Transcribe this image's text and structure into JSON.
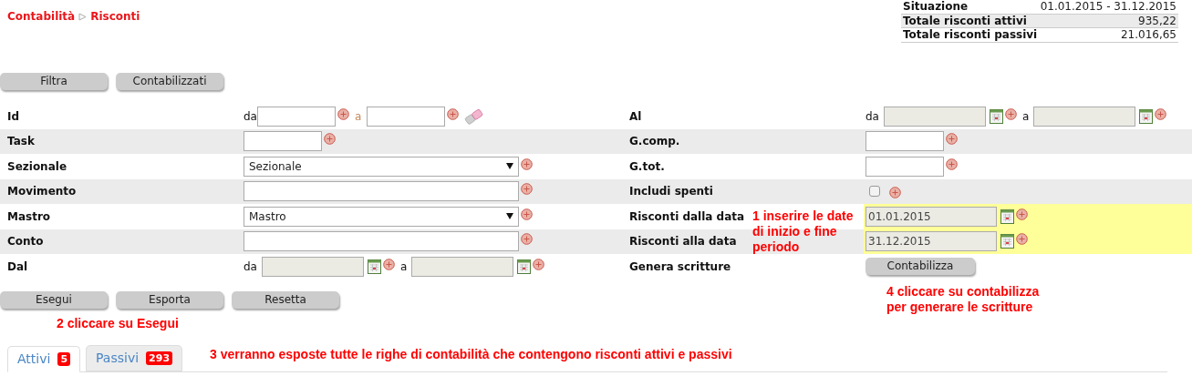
{
  "breadcrumb": [
    {
      "label": "Contabilità"
    },
    {
      "label": "Risconti"
    }
  ],
  "summary": [
    {
      "label": "Situazione",
      "value": "01.01.2015 - 31.12.2015"
    },
    {
      "label": "Totale risconti attivi",
      "value": "935,22"
    },
    {
      "label": "Totale risconti passivi",
      "value": "21.016,65"
    }
  ],
  "top_buttons": [
    "Filtra",
    "Contabilizzati"
  ],
  "filters_left": [
    {
      "label": "Id",
      "kind": "range",
      "from": "da",
      "to": "a"
    },
    {
      "label": "Task",
      "kind": "short"
    },
    {
      "label": "Sezionale",
      "kind": "select",
      "value": "Sezionale"
    },
    {
      "label": "Movimento",
      "kind": "text"
    },
    {
      "label": "Mastro",
      "kind": "select",
      "value": "Mastro"
    },
    {
      "label": "Conto",
      "kind": "text"
    },
    {
      "label": "Dal",
      "kind": "daterange",
      "from": "da",
      "to": "a"
    }
  ],
  "filters_right": [
    {
      "label": "Al",
      "kind": "daterange",
      "from": "da",
      "to": "a"
    },
    {
      "label": "G.comp.",
      "kind": "short"
    },
    {
      "label": "G.tot.",
      "kind": "short"
    },
    {
      "label": "Includi spenti",
      "kind": "checkbox",
      "checked": false
    },
    {
      "label": "Risconti dalla data",
      "kind": "date",
      "value": "01.01.2015",
      "highlighted": true
    },
    {
      "label": "Risconti alla data",
      "kind": "date",
      "value": "31.12.2015",
      "highlighted": true
    },
    {
      "label": "Genera scritture",
      "kind": "button",
      "button": "Contabilizza"
    }
  ],
  "action_buttons": [
    "Esegui",
    "Esporta",
    "Resetta"
  ],
  "tabs": [
    {
      "label": "Attivi",
      "count": "5",
      "selected": true
    },
    {
      "label": "Passivi",
      "count": "293",
      "selected": false
    }
  ],
  "annotations": [
    "1 inserire le date di inizio e fine periodo",
    "2 cliccare su Esegui",
    "3 verranno esposte tutte le righe di contabilità che contengono risconti attivi e passivi",
    "4 cliccare su contabilizza per generare le scritture"
  ]
}
